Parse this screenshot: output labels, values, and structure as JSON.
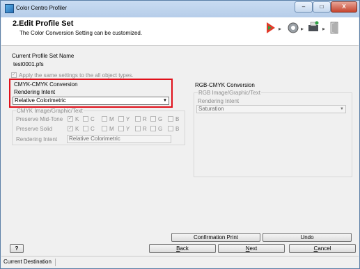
{
  "window": {
    "title": "Color Centro Profiler",
    "minimize": "–",
    "maximize": "□",
    "close": "X"
  },
  "header": {
    "step_title": "2.Edit Profile Set",
    "description": "The Color   Conversion Setting can be customized."
  },
  "profile_set": {
    "label": "Current Profile Set Name",
    "value": "test0001.pfs"
  },
  "apply_all": {
    "label": "Apply the same settings to the all object types.",
    "checked": "✓"
  },
  "cmyk": {
    "section_title": "CMYK-CMYK Conversion",
    "rendering_label": "Rendering Intent",
    "rendering_value": "Relative Colorimetric",
    "image_group_title": "CMYK Image/Graphic/Text",
    "preserve_midtone_label": "Preserve Mid-Tone",
    "preserve_solid_label": "Preserve Solid",
    "channels": [
      "K",
      "C",
      "M",
      "Y",
      "R",
      "G",
      "B"
    ],
    "rendering_intent_label": "Rendering Intent",
    "rendering_intent_value": "Relative Colorimetric"
  },
  "rgb": {
    "section_title": "RGB-CMYK Conversion",
    "image_group_title": "RGB Image/Graphic/Text",
    "rendering_label": "Rendering Intent",
    "rendering_value": "Saturation"
  },
  "buttons": {
    "confirmation_print": "Confirmation Print",
    "undo": "Undo",
    "help": "?"
  },
  "nav": {
    "back_prefix": "B",
    "back_rest": "ack",
    "next_prefix": "N",
    "next_rest": "ext",
    "cancel_prefix": "C",
    "cancel_rest": "ancel"
  },
  "status": {
    "current_destination": "Current Destination"
  },
  "colors": {
    "highlight": "#e0101a",
    "title_bar": "#c9dcf2"
  }
}
